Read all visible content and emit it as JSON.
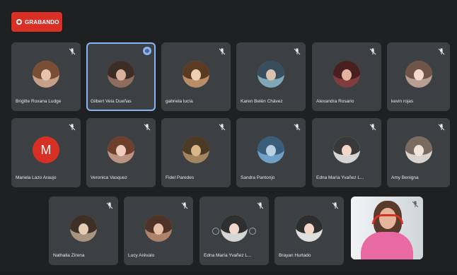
{
  "recording": {
    "label": "GRABANDO"
  },
  "participants": [
    {
      "name": "Brigitte Roxana Ludge"
    },
    {
      "name": "Gilbert Vela Dueñas"
    },
    {
      "name": "gabriela lucía"
    },
    {
      "name": "Karen Belén Chávez"
    },
    {
      "name": "Alexandra Rosario"
    },
    {
      "name": "kevin rojas"
    },
    {
      "name": "Mariela Lazo Araujo",
      "initial": "M"
    },
    {
      "name": "Veronica Vasquez"
    },
    {
      "name": "Fidel Paredes"
    },
    {
      "name": "Sandra Pantonjo"
    },
    {
      "name": "Edna María Yvañez L..."
    },
    {
      "name": "Amy Benigna"
    },
    {
      "name": "Nathalia Zírena"
    },
    {
      "name": "Lucy Arévalo"
    },
    {
      "name": "Edna María Yvañez L..."
    },
    {
      "name": "Brayan Hurtado"
    }
  ],
  "colors": {
    "tile": "#3c4043",
    "active_outline": "#8ab4f8",
    "record_badge": "#d93025"
  }
}
